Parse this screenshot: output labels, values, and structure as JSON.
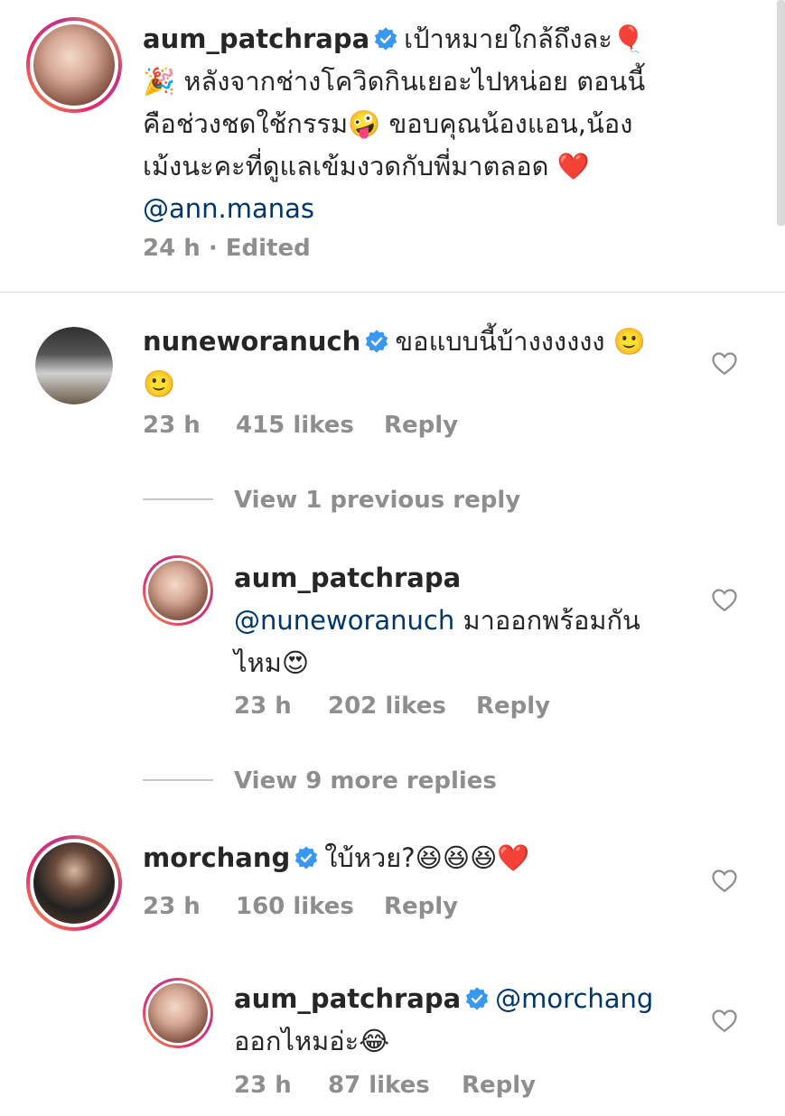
{
  "scrollbar": true,
  "caption": {
    "username": "aum_patchrapa",
    "text_line1": "เป้าหมายใกล้ถึงละ🎈",
    "text_line2": "🎉 หลังจากช่างโควิดกินเยอะไปหน่อย ตอนนี้",
    "text_line3": "คือช่วงชดใช้กรรม🤪 ขอบคุณน้องแอน,น้อง",
    "text_line4": "เม้งนะคะที่ดูแลเข้มงวดกับพี่มาตลอด ❤️",
    "mention": "@ann.manas",
    "time": "24 h",
    "separator": "·",
    "edited": "Edited"
  },
  "comments": [
    {
      "username": "nuneworanuch",
      "text_line1": "ขอแบบนี้บ้างงงงงง 🙂",
      "text_line2": "🙂",
      "time": "23 h",
      "likes": "415 likes",
      "reply": "Reply",
      "view_replies": "View 1 previous reply"
    },
    {
      "username": "aum_patchrapa",
      "mention": "@nuneworanuch",
      "text_line1": " มาออกพร้อมกัน",
      "text_line2": "ไหม😍",
      "time": "23 h",
      "likes": "202 likes",
      "reply": "Reply",
      "view_replies": "View 9 more replies"
    },
    {
      "username": "morchang",
      "text_line1": "ใบ้หวย?😆😆😆❤️",
      "time": "23 h",
      "likes": "160 likes",
      "reply": "Reply"
    },
    {
      "username": "aum_patchrapa",
      "mention": "@morchang",
      "text_line2": "ออกไหมอ่ะ😂",
      "time": "23 h",
      "likes": "87 likes",
      "reply": "Reply"
    }
  ],
  "colors": {
    "verified": "#3897f0",
    "mention": "#00376b",
    "meta": "#8e8e8e"
  }
}
